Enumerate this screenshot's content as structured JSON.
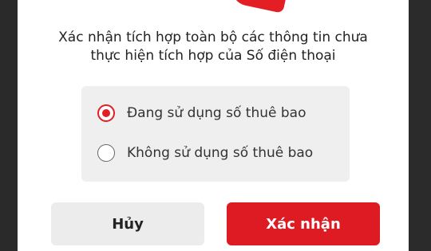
{
  "dialog": {
    "message_line1": "Xác nhận tích hợp toàn bộ các thông tin chưa",
    "message_line2": "thực hiện tích hợp của Số điện thoại",
    "options": [
      {
        "label": "Đang sử dụng số thuê bao",
        "selected": true
      },
      {
        "label": "Không sử dụng số thuê bao",
        "selected": false
      }
    ],
    "cancel_label": "Hủy",
    "confirm_label": "Xác nhận"
  },
  "colors": {
    "accent": "#e31e24",
    "panel_bg": "#efefef",
    "cancel_bg": "#ececec",
    "backdrop": "#262626"
  }
}
